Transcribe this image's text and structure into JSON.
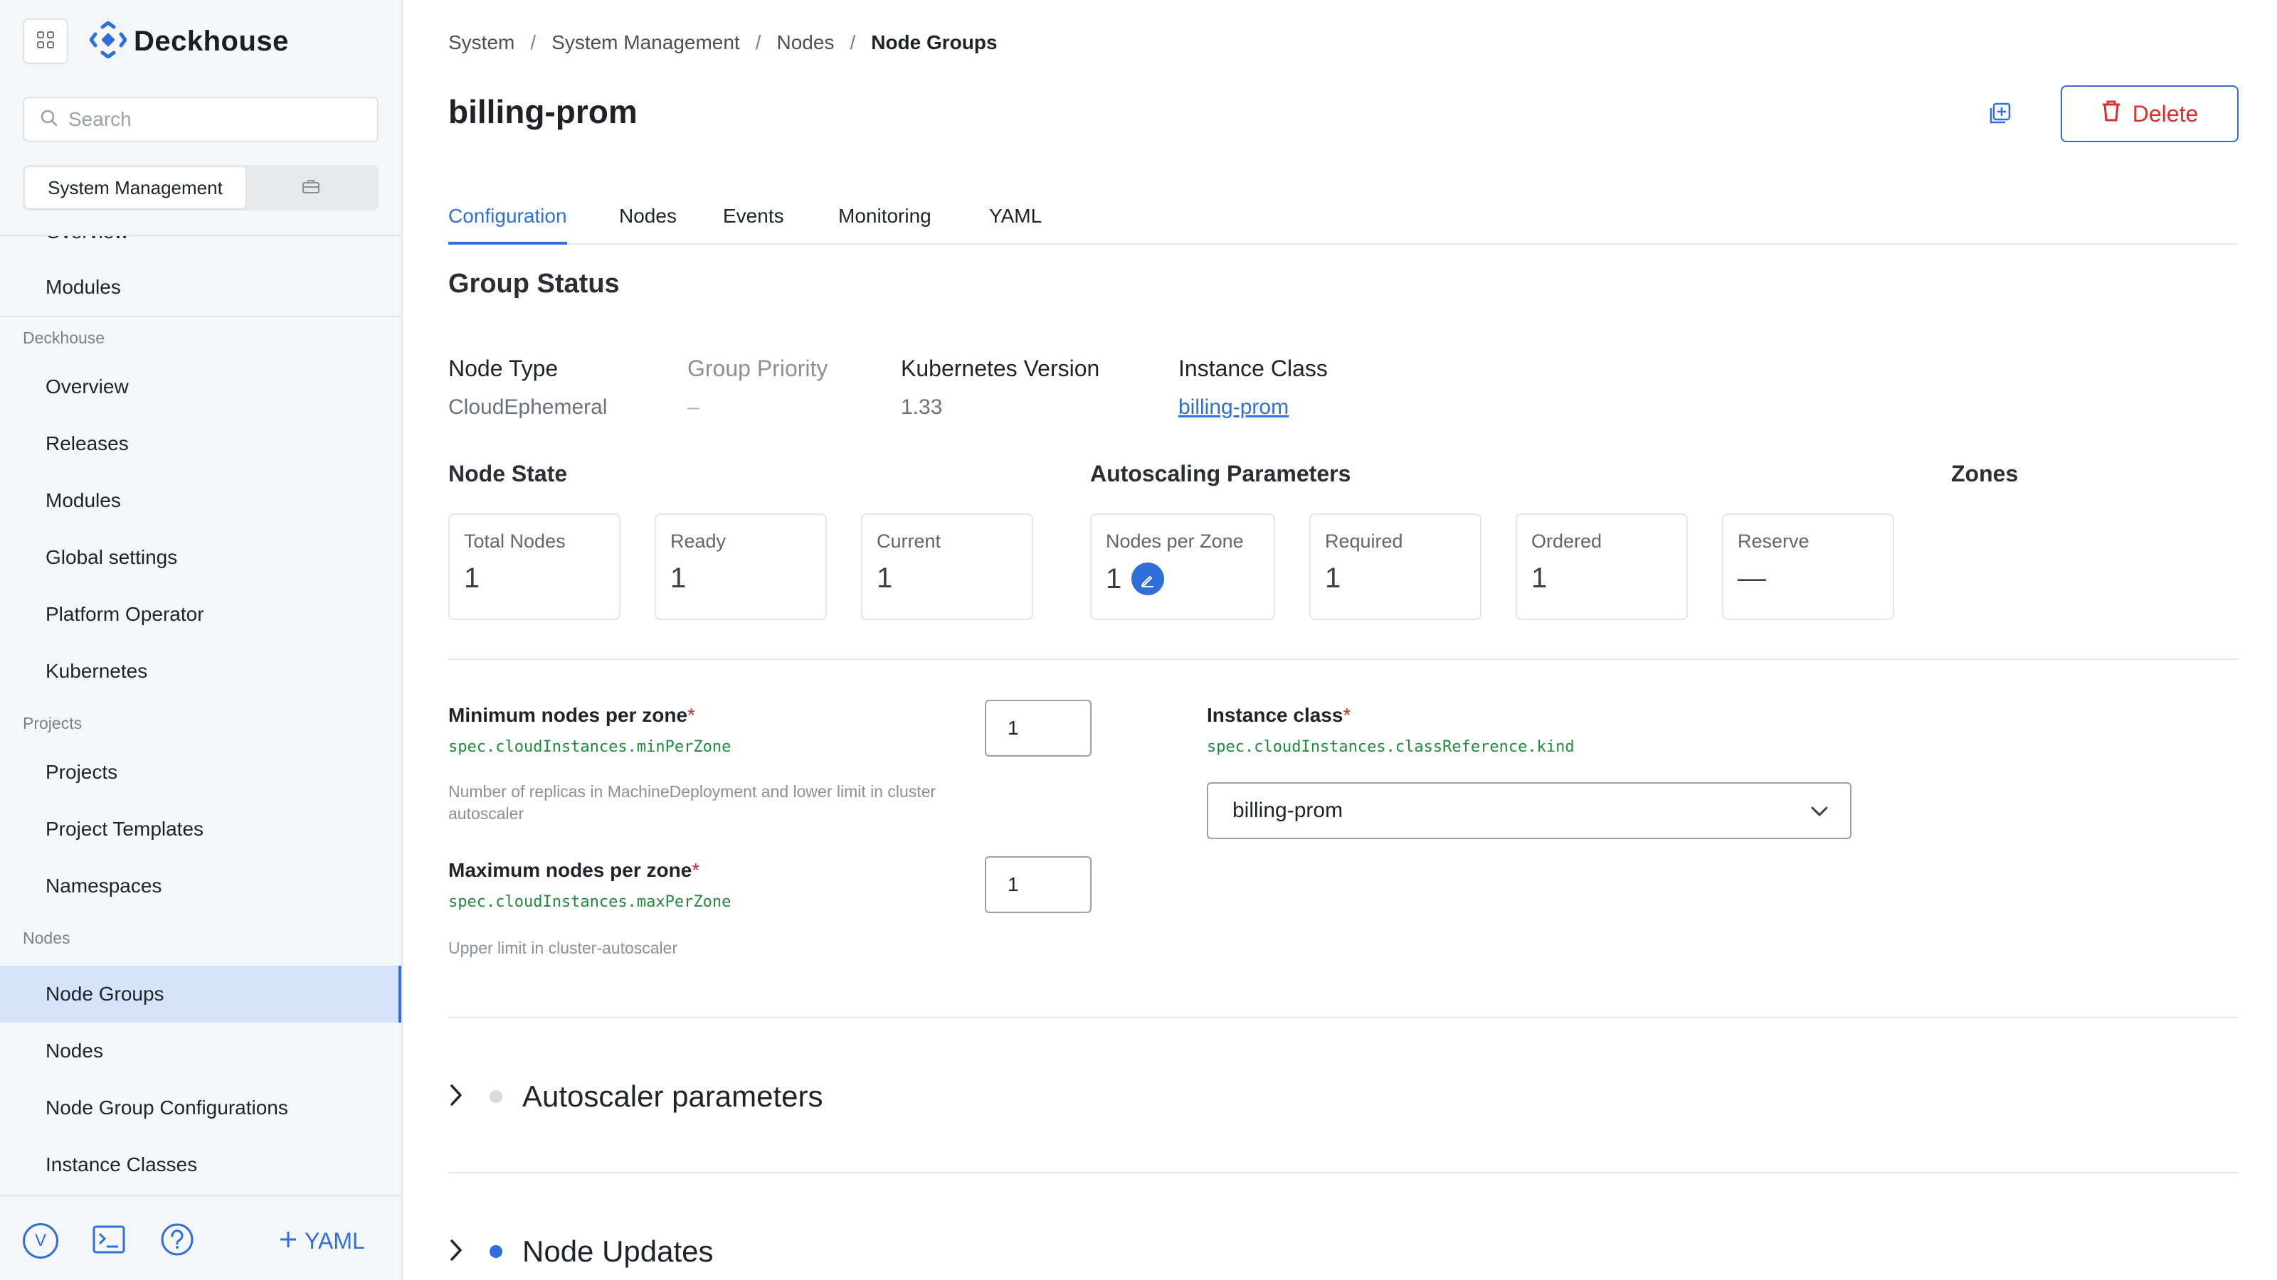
{
  "sidebar": {
    "brand": "Deckhouse",
    "search_placeholder": "Search",
    "segment": {
      "active": "System Management"
    },
    "cut_item": "Overview",
    "items_top": [
      {
        "label": "Modules"
      }
    ],
    "sections": [
      {
        "title": "Deckhouse",
        "items": [
          "Overview",
          "Releases",
          "Modules",
          "Global settings",
          "Platform Operator",
          "Kubernetes"
        ]
      },
      {
        "title": "Projects",
        "items": [
          "Projects",
          "Project Templates",
          "Namespaces"
        ]
      },
      {
        "title": "Nodes",
        "items": [
          "Node Groups",
          "Nodes",
          "Node Group Configurations",
          "Instance Classes"
        ]
      }
    ],
    "active_item": "Node Groups",
    "footer": {
      "avatar_letter": "V",
      "yaml_label": "YAML"
    }
  },
  "breadcrumb": [
    "System",
    "System Management",
    "Nodes",
    "Node Groups"
  ],
  "page": {
    "title": "billing-prom",
    "delete_label": "Delete"
  },
  "tabs": [
    "Configuration",
    "Nodes",
    "Events",
    "Monitoring",
    "YAML"
  ],
  "active_tab": "Configuration",
  "group_status": {
    "heading": "Group Status",
    "node_type": {
      "label": "Node Type",
      "value": "CloudEphemeral"
    },
    "group_priority": {
      "label": "Group Priority",
      "value": "–"
    },
    "kubernetes_version": {
      "label": "Kubernetes Version",
      "value": "1.33"
    },
    "instance_class": {
      "label": "Instance Class",
      "value": "billing-prom"
    }
  },
  "node_state": {
    "heading": "Node State",
    "cards": [
      {
        "label": "Total Nodes",
        "value": "1"
      },
      {
        "label": "Ready",
        "value": "1"
      },
      {
        "label": "Current",
        "value": "1"
      }
    ]
  },
  "autoscaling": {
    "heading": "Autoscaling Parameters",
    "cards": [
      {
        "label": "Nodes per Zone",
        "value": "1"
      },
      {
        "label": "Required",
        "value": "1"
      },
      {
        "label": "Ordered",
        "value": "1"
      },
      {
        "label": "Reserve",
        "value": "—"
      }
    ]
  },
  "zones": {
    "heading": "Zones"
  },
  "form": {
    "min_nodes": {
      "label": "Minimum nodes per zone",
      "required_mark": "*",
      "path": "spec.cloudInstances.minPerZone",
      "help": "Number of replicas in MachineDeployment and lower limit in cluster autoscaler",
      "value": "1"
    },
    "max_nodes": {
      "label": "Maximum nodes per zone",
      "required_mark": "*",
      "path": "spec.cloudInstances.maxPerZone",
      "help": "Upper limit in cluster-autoscaler",
      "value": "1"
    },
    "instance_class": {
      "label": "Instance class",
      "required_mark": "*",
      "path": "spec.cloudInstances.classReference.kind",
      "value": "billing-prom"
    }
  },
  "collapsibles": [
    {
      "title": "Autoscaler parameters",
      "dot_color": "#d7d9dd"
    },
    {
      "title": "Node Updates",
      "dot_color": "#2f6fdb"
    }
  ],
  "colors": {
    "accent": "#2f6fdb",
    "danger": "#e02b2b",
    "path_green": "#1f8a3b",
    "active_nav_bg": "#d6e4fb"
  }
}
